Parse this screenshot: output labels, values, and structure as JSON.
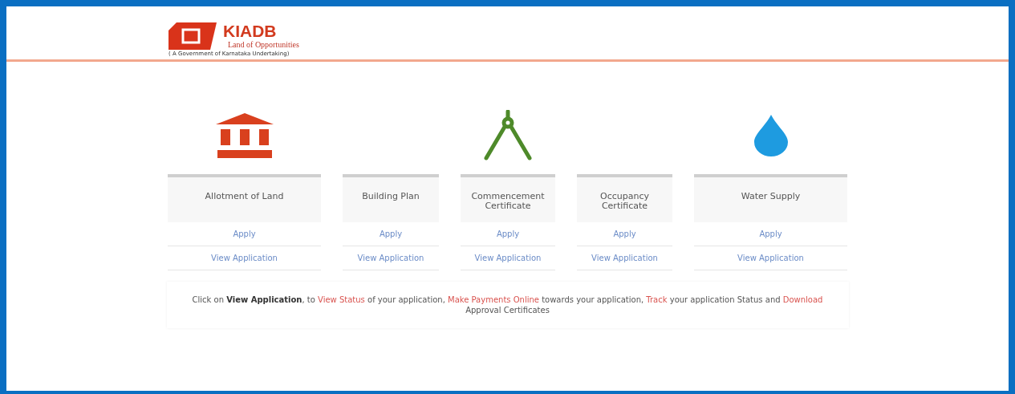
{
  "header": {
    "logo": {
      "name": "KIADB",
      "tagline": "Land of Opportunities",
      "subtitle": "( A Government of Karnataka Undertaking)"
    }
  },
  "services": [
    {
      "title": "Allotment of Land",
      "actions": [
        "Apply",
        "View Application"
      ]
    },
    {
      "title": "Building Plan",
      "actions": [
        "Apply",
        "View Application"
      ]
    },
    {
      "title": "Commencement Certificate",
      "actions": [
        "Apply",
        "View Application"
      ]
    },
    {
      "title": "Occupancy Certificate",
      "actions": [
        "Apply",
        "View Application"
      ]
    },
    {
      "title": "Water Supply",
      "actions": [
        "Apply",
        "View Application"
      ]
    }
  ],
  "info": [
    {
      "kind": "plain",
      "text": "Click on "
    },
    {
      "kind": "bold",
      "text": "View Application"
    },
    {
      "kind": "plain",
      "text": ", to "
    },
    {
      "kind": "link",
      "text": "View Status"
    },
    {
      "kind": "plain",
      "text": " of your application, "
    },
    {
      "kind": "link",
      "text": "Make Payments Online"
    },
    {
      "kind": "plain",
      "text": " towards your application, "
    },
    {
      "kind": "link",
      "text": "Track"
    },
    {
      "kind": "plain",
      "text": " your application Status and "
    },
    {
      "kind": "link",
      "text": "Download"
    },
    {
      "kind": "plain",
      "text": " Approval Certificates"
    }
  ]
}
